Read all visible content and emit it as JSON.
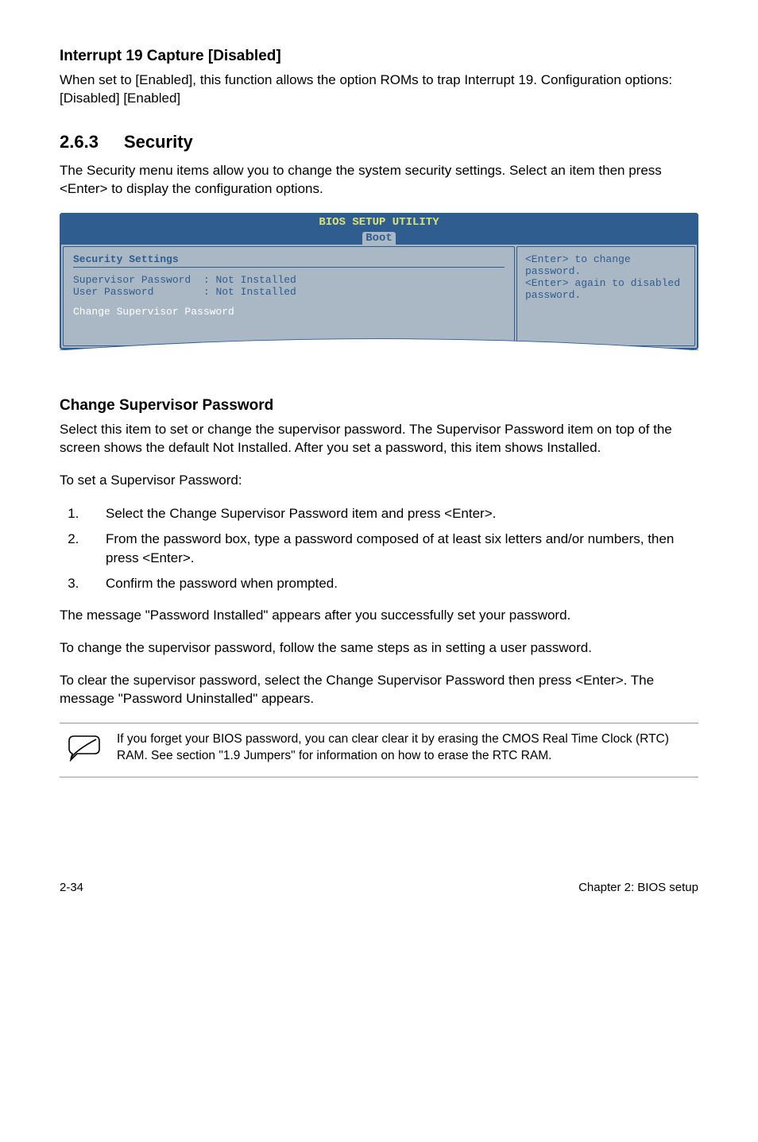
{
  "section1": {
    "heading": "Interrupt 19 Capture [Disabled]",
    "body": "When set to [Enabled], this function allows the option ROMs to trap Interrupt 19. Configuration options: [Disabled] [Enabled]"
  },
  "section2": {
    "number": "2.6.3",
    "title": "Security",
    "body": "The Security menu items allow you to change the system security settings. Select an item then press <Enter> to display the configuration options."
  },
  "bios": {
    "utility_title": "BIOS SETUP UTILITY",
    "tab": "Boot",
    "settings_title": "Security Settings",
    "rows": [
      {
        "label": "Supervisor Password",
        "value": ": Not Installed"
      },
      {
        "label": "User Password      ",
        "value": ": Not Installed"
      }
    ],
    "selected_item": "Change Supervisor Password",
    "help_text": "<Enter> to change password.\n<Enter> again to disabled password."
  },
  "section3": {
    "heading": "Change Supervisor Password",
    "p1": "Select this item to set or change the supervisor password. The Supervisor Password item on top of the screen shows the default Not Installed. After you set a password, this item shows Installed.",
    "p2": "To set a Supervisor Password:",
    "steps": [
      "Select the Change Supervisor Password item and press <Enter>.",
      "From the password box, type a password composed of at least six letters and/or numbers, then press <Enter>.",
      "Confirm the password when prompted."
    ],
    "p3": "The message \"Password Installed\" appears after you successfully set your password.",
    "p4": "To change the supervisor password, follow the same steps as in setting a user password.",
    "p5": "To clear the supervisor password, select the Change Supervisor Password then press <Enter>. The message \"Password Uninstalled\" appears."
  },
  "note": {
    "text": "If you forget your BIOS password, you can clear clear it by erasing the CMOS Real Time Clock (RTC) RAM. See section \"1.9 Jumpers\" for information on how to erase the RTC RAM."
  },
  "footer": {
    "left": "2-34",
    "right": "Chapter 2: BIOS setup"
  }
}
